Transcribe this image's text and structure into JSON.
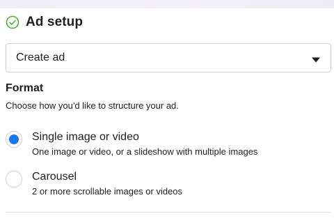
{
  "ad_setup": {
    "title": "Ad setup",
    "status_icon": "check-circle-icon",
    "status_color": "#42b72a",
    "select": {
      "value": "Create ad",
      "icon": "caret-down-icon"
    }
  },
  "format": {
    "heading": "Format",
    "description": "Choose how you'd like to structure your ad.",
    "options": [
      {
        "label": "Single image or video",
        "description": "One image or video, or a slideshow with multiple images",
        "selected": true
      },
      {
        "label": "Carousel",
        "description": "2 or more scrollable images or videos",
        "selected": false
      }
    ]
  },
  "colors": {
    "accent": "#1877f2",
    "text": "#1c1e21",
    "border": "#ccd0d5"
  }
}
